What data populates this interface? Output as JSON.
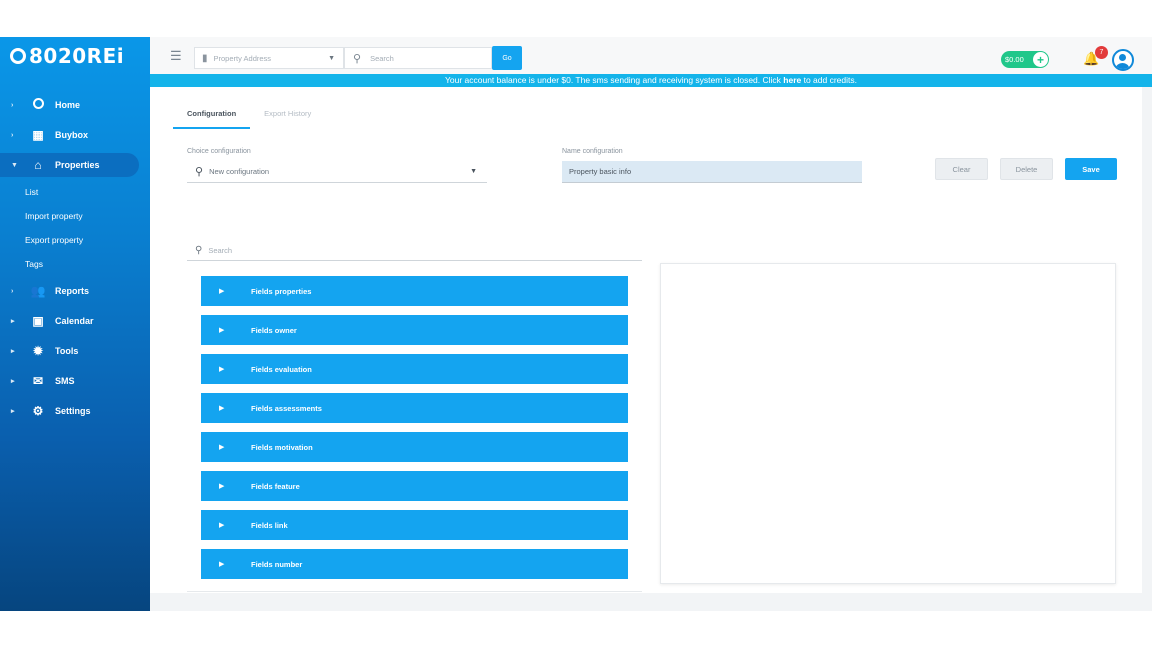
{
  "brand": {
    "logo_text": "8020REi"
  },
  "sidebar": {
    "items": [
      {
        "label": "Home",
        "icon": "home-ring-icon"
      },
      {
        "label": "Buybox",
        "icon": "buybox-icon"
      },
      {
        "label": "Properties",
        "icon": "house-icon",
        "active": true
      },
      {
        "label": "Reports",
        "icon": "people-icon"
      },
      {
        "label": "Calendar",
        "icon": "calendar-icon"
      },
      {
        "label": "Tools",
        "icon": "tools-icon"
      },
      {
        "label": "SMS",
        "icon": "envelope-icon"
      },
      {
        "label": "Settings",
        "icon": "gear-icon"
      }
    ],
    "subitems": [
      "List",
      "Import property",
      "Export property",
      "Tags"
    ]
  },
  "topbar": {
    "address_placeholder": "Property Address",
    "search_placeholder": "Search",
    "go_label": "Go",
    "balance": "$0.00",
    "notification_count": "7"
  },
  "banner": {
    "text_before": "Your account balance is under $0. The sms sending and receiving system is closed. Click ",
    "link_text": "here",
    "text_after": " to add credits."
  },
  "tabs": [
    {
      "label": "Configuration",
      "active": true
    },
    {
      "label": "Export History",
      "active": false
    }
  ],
  "form": {
    "choice_label": "Choice configuration",
    "choice_value": "New configuration",
    "name_label": "Name configuration",
    "name_value": "Property basic info",
    "clear_label": "Clear",
    "delete_label": "Delete",
    "save_label": "Save"
  },
  "fields": {
    "search_placeholder": "Search",
    "groups": [
      "Fields properties",
      "Fields owner",
      "Fields evaluation",
      "Fields assessments",
      "Fields motivation",
      "Fields feature",
      "Fields link",
      "Fields number"
    ]
  },
  "colors": {
    "accent": "#14a4f0",
    "banner": "#14b4ea",
    "balance": "#20c78a",
    "badge": "#e23b3b"
  }
}
